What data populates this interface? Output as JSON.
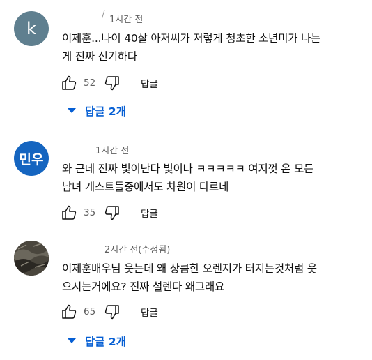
{
  "comments": [
    {
      "author_fragment": "/",
      "time": "1시간 전",
      "avatar_letter": "k",
      "text": "이제훈...나이 40살 아저씨가 저렇게 청초한 소년미가 나는\n게 진짜 신기하다",
      "likes": "52",
      "reply_label": "답글",
      "replies_label": "답글 2개"
    },
    {
      "time": "1시간 전",
      "avatar_letter": "민우",
      "text": "와 근데 진짜 빛이난다 빛이나 ㅋㅋㅋㅋㅋ 여지껏 온 모든\n남녀 게스트들중에서도 차원이 다르네",
      "likes": "35",
      "reply_label": "답글"
    },
    {
      "time": "2시간 전(수정됨)",
      "text": "이제훈배우님 웃는데 왜 상큼한 오렌지가 터지는것처럼 웃\n으시는거에요? 진짜 설렌다 왜그래요",
      "likes": "65",
      "reply_label": "답글",
      "replies_label": "답글 2개"
    }
  ],
  "colors": {
    "accent": "#065fd4",
    "secondary_text": "#606060",
    "avatar_k": "#5f7f8f",
    "avatar_m": "#1565c0"
  },
  "icons": [
    "thumb-up-icon",
    "thumb-down-icon",
    "chevron-down-icon"
  ]
}
